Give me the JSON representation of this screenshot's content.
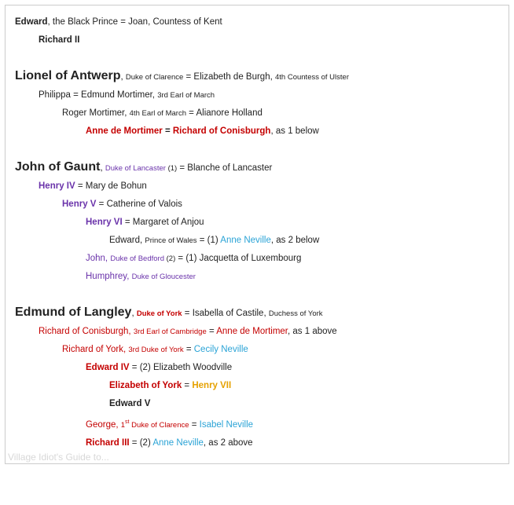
{
  "watermark": "Village Idiot's Guide to...",
  "sections": {
    "edward_bp": {
      "name": "Edward",
      "title": ", the Black Prince",
      "eq": " = ",
      "spouse": "Joan, Countess of Kent",
      "child": "Richard II"
    },
    "lionel": {
      "name": "Lionel of Antwerp",
      "comma": ", ",
      "title": "Duke of Clarence",
      "eq": " = ",
      "spouse": "Elizabeth de Burgh, ",
      "spouse_title": "4th Countess of Ulster",
      "c1_name": "Philippa",
      "c1_eq": " = ",
      "c1_spouse": "Edmund Mortimer, ",
      "c1_spouse_title": "3rd Earl of March",
      "c2_name": "Roger Mortimer, ",
      "c2_title": "4th Earl of March",
      "c2_eq": " = ",
      "c2_spouse": "Alianore Holland",
      "c3_name": "Anne de Mortimer",
      "c3_eq": " = ",
      "c3_spouse": "Richard of Conisburgh",
      "c3_note": ", as 1 below"
    },
    "gaunt": {
      "name": "John of Gaunt",
      "comma": ", ",
      "title": "Duke of Lancaster",
      "num": " (1)",
      "eq": " = ",
      "spouse": "Blanche of Lancaster",
      "h4": "Henry IV",
      "h4_eq": " = ",
      "h4_spouse": "Mary de Bohun",
      "h5": "Henry V",
      "h5_eq": " = ",
      "h5_spouse": "Catherine of Valois",
      "h6": "Henry VI",
      "h6_eq": " = ",
      "h6_spouse": "Margaret of Anjou",
      "edw": "Edward, ",
      "edw_title": "Prince of Wales",
      "edw_eq": " = (1) ",
      "edw_spouse": "Anne Neville",
      "edw_note": ", as 2 below",
      "john": "John, ",
      "john_title": "Duke of Bedford",
      "john_num": " (2)",
      "john_eq": " = (1) ",
      "john_spouse": "Jacquetta of Luxembourg",
      "humphrey": "Humphrey, ",
      "humphrey_title": "Duke of Gloucester"
    },
    "langley": {
      "name": "Edmund of Langley",
      "comma": ", ",
      "title": "Duke of York",
      "eq": " = ",
      "spouse": "Isabella of Castile, ",
      "spouse_title": "Duchess of York",
      "rc": "Richard of Conisburgh, ",
      "rc_title": "3rd Earl of Cambridge",
      "rc_eq": " = ",
      "rc_spouse": "Anne de Mortimer",
      "rc_note": ", as 1 above",
      "ry": "Richard of York, ",
      "ry_title": "3rd Duke of York",
      "ry_eq": " = ",
      "ry_spouse": "Cecily Neville",
      "e4": "Edward IV",
      "e4_eq": " = (2) ",
      "e4_spouse": "Elizabeth Woodville",
      "eoy": "Elizabeth of York",
      "eoy_eq": " = ",
      "eoy_spouse": "Henry VII",
      "e5": "Edward V",
      "geo": "George, ",
      "geo_1": "1",
      "geo_st": "st",
      "geo_title": " Duke of Clarence",
      "geo_eq": " = ",
      "geo_spouse": "Isabel Neville",
      "r3": "Richard III",
      "r3_eq": " = (2) ",
      "r3_spouse": "Anne Neville",
      "r3_note": ", as 2 above"
    }
  }
}
